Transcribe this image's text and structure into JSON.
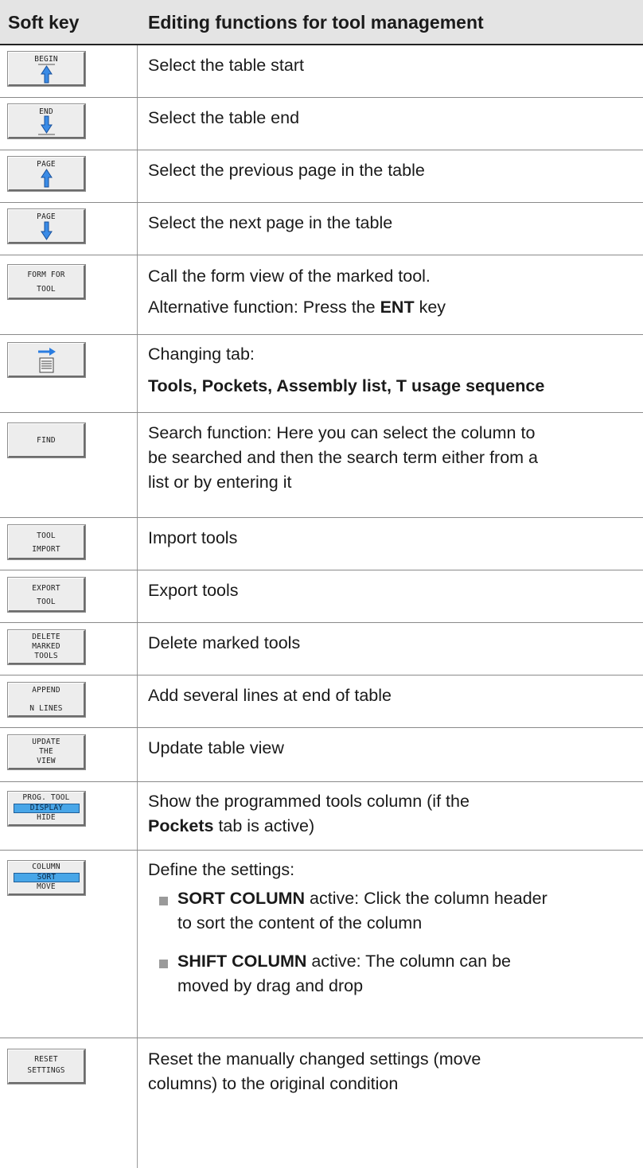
{
  "header": {
    "col1": "Soft key",
    "col2": "Editing functions for tool management"
  },
  "rows": [
    {
      "key": [
        "BEGIN"
      ],
      "desc": "Select the table start"
    },
    {
      "key": [
        "END"
      ],
      "desc": "Select the table end"
    },
    {
      "key": [
        "PAGE"
      ],
      "desc": "Select the previous page in the table"
    },
    {
      "key": [
        "PAGE"
      ],
      "desc": "Select the next page in the table"
    },
    {
      "key": [
        "FORM FOR",
        "TOOL"
      ],
      "desc": "Call the form view of the marked tool.",
      "desc2_pre": "Alternative function: Press the ",
      "desc2_bold": "ENT",
      "desc2_post": " key"
    },
    {
      "key_icon": "tab-change-icon",
      "desc": "Changing tab:",
      "tabs": [
        "Tools",
        "Pockets",
        "Assembly list",
        "T usage sequence"
      ],
      "tabs_sep": ", "
    },
    {
      "key": [
        "FIND"
      ],
      "desc_lines": [
        "Search function: Here you can select the column to",
        "be searched and then the search term either from a",
        "list or by entering it"
      ]
    },
    {
      "key": [
        "TOOL",
        "IMPORT"
      ],
      "desc": "Import tools"
    },
    {
      "key": [
        "EXPORT",
        "TOOL"
      ],
      "desc": "Export tools"
    },
    {
      "key": [
        "DELETE",
        "MARKED",
        "TOOLS"
      ],
      "desc": "Delete marked tools"
    },
    {
      "key": [
        "APPEND",
        "N LINES"
      ],
      "desc": "Add several lines at end of table"
    },
    {
      "key": [
        "UPDATE",
        "THE",
        "VIEW"
      ],
      "desc": "Update table view"
    },
    {
      "key": [
        "PROG. TOOL",
        "DISPLAY",
        "HIDE"
      ],
      "desc_line1": "Show the programmed tools column (if the",
      "desc_line2_bold": "Pockets",
      "desc_line2_post": " tab is active)"
    },
    {
      "key": [
        "COLUMN",
        "SORT",
        "MOVE"
      ],
      "desc": "Define the settings:",
      "bullets": [
        {
          "bold": "SORT COLUMN",
          "text": " active: Click the column header",
          "text2": "to sort the content of the column"
        },
        {
          "bold": "SHIFT COLUMN",
          "text": " active: The column can be",
          "text2": "moved by drag and drop"
        }
      ]
    },
    {
      "key": [
        "RESET",
        "SETTINGS"
      ],
      "desc_lines": [
        "Reset the manually changed settings (move",
        "columns) to the original condition"
      ]
    }
  ],
  "colors": {
    "header_bg": "#e4e4e4",
    "arrow": "#2a7de1",
    "highlight": "#48a6e8"
  }
}
